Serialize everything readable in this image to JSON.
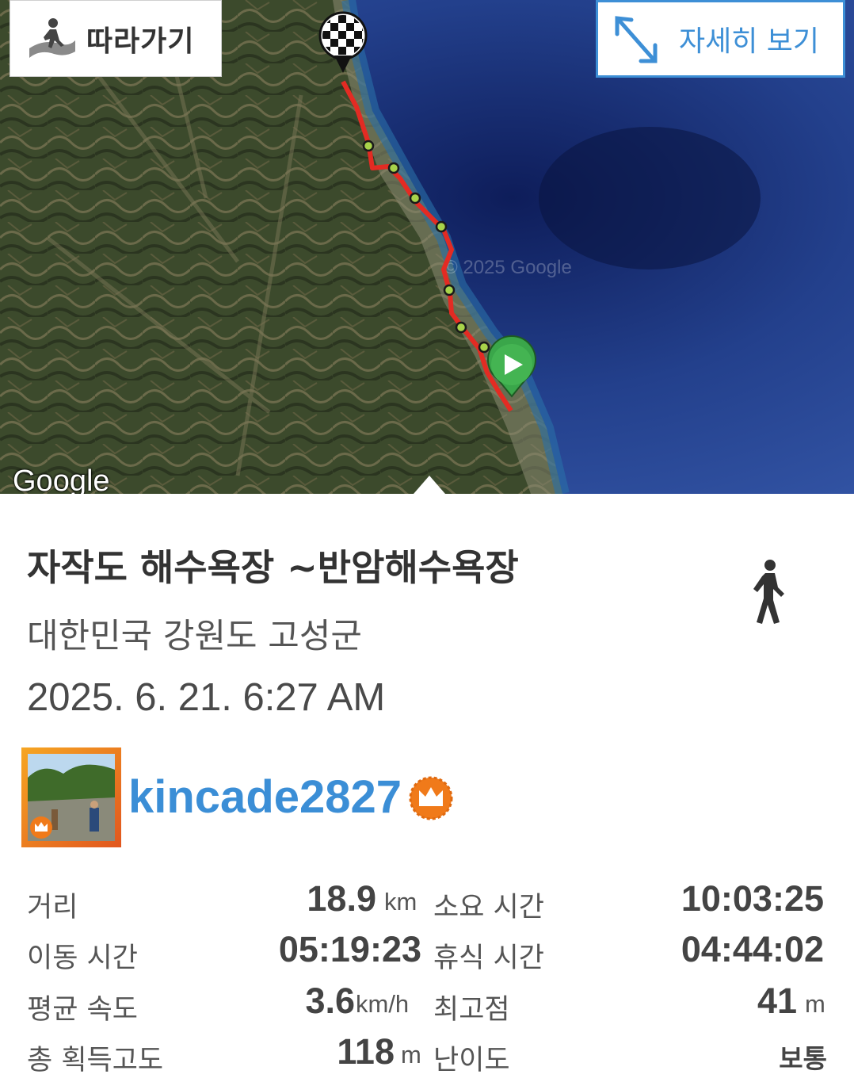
{
  "map": {
    "follow_label": "따라가기",
    "detail_label": "자세히 보기",
    "provider_logo": "Google",
    "watermark": "© 2025 Google",
    "icons": [
      "hiker-follow-icon",
      "expand-arrows-icon",
      "finish-flag-icon",
      "start-play-pin-icon"
    ],
    "colors": {
      "route": "#e32b23",
      "waypoint": "#a8d34a",
      "start_pin": "#3aa64a",
      "sea": "#1f3f8f"
    }
  },
  "trail": {
    "title": "자작도 해수욕장 ~반암해수욕장",
    "location": "대한민국 강원도 고성군",
    "datetime": "2025. 6. 21. 6:27 AM",
    "activity_icon": "walking-person-icon"
  },
  "user": {
    "name": "kincade2827",
    "badge_icon": "crown-icon",
    "colors": {
      "name": "#3b8ed6",
      "badge": "#f07a1a"
    }
  },
  "stats": {
    "distance": {
      "label": "거리",
      "value": "18.9",
      "unit": "km"
    },
    "total_time": {
      "label": "소요 시간",
      "value": "10:03:25"
    },
    "moving_time": {
      "label": "이동 시간",
      "value": "05:19:23"
    },
    "rest_time": {
      "label": "휴식 시간",
      "value": "04:44:02"
    },
    "avg_speed": {
      "label": "평균 속도",
      "value": "3.6",
      "unit": "km/h"
    },
    "max_altitude": {
      "label": "최고점",
      "value": "41",
      "unit": "m"
    },
    "total_ascent": {
      "label": "총 획득고도",
      "value": "118",
      "unit": "m"
    },
    "difficulty": {
      "label": "난이도",
      "value": "보통"
    }
  }
}
